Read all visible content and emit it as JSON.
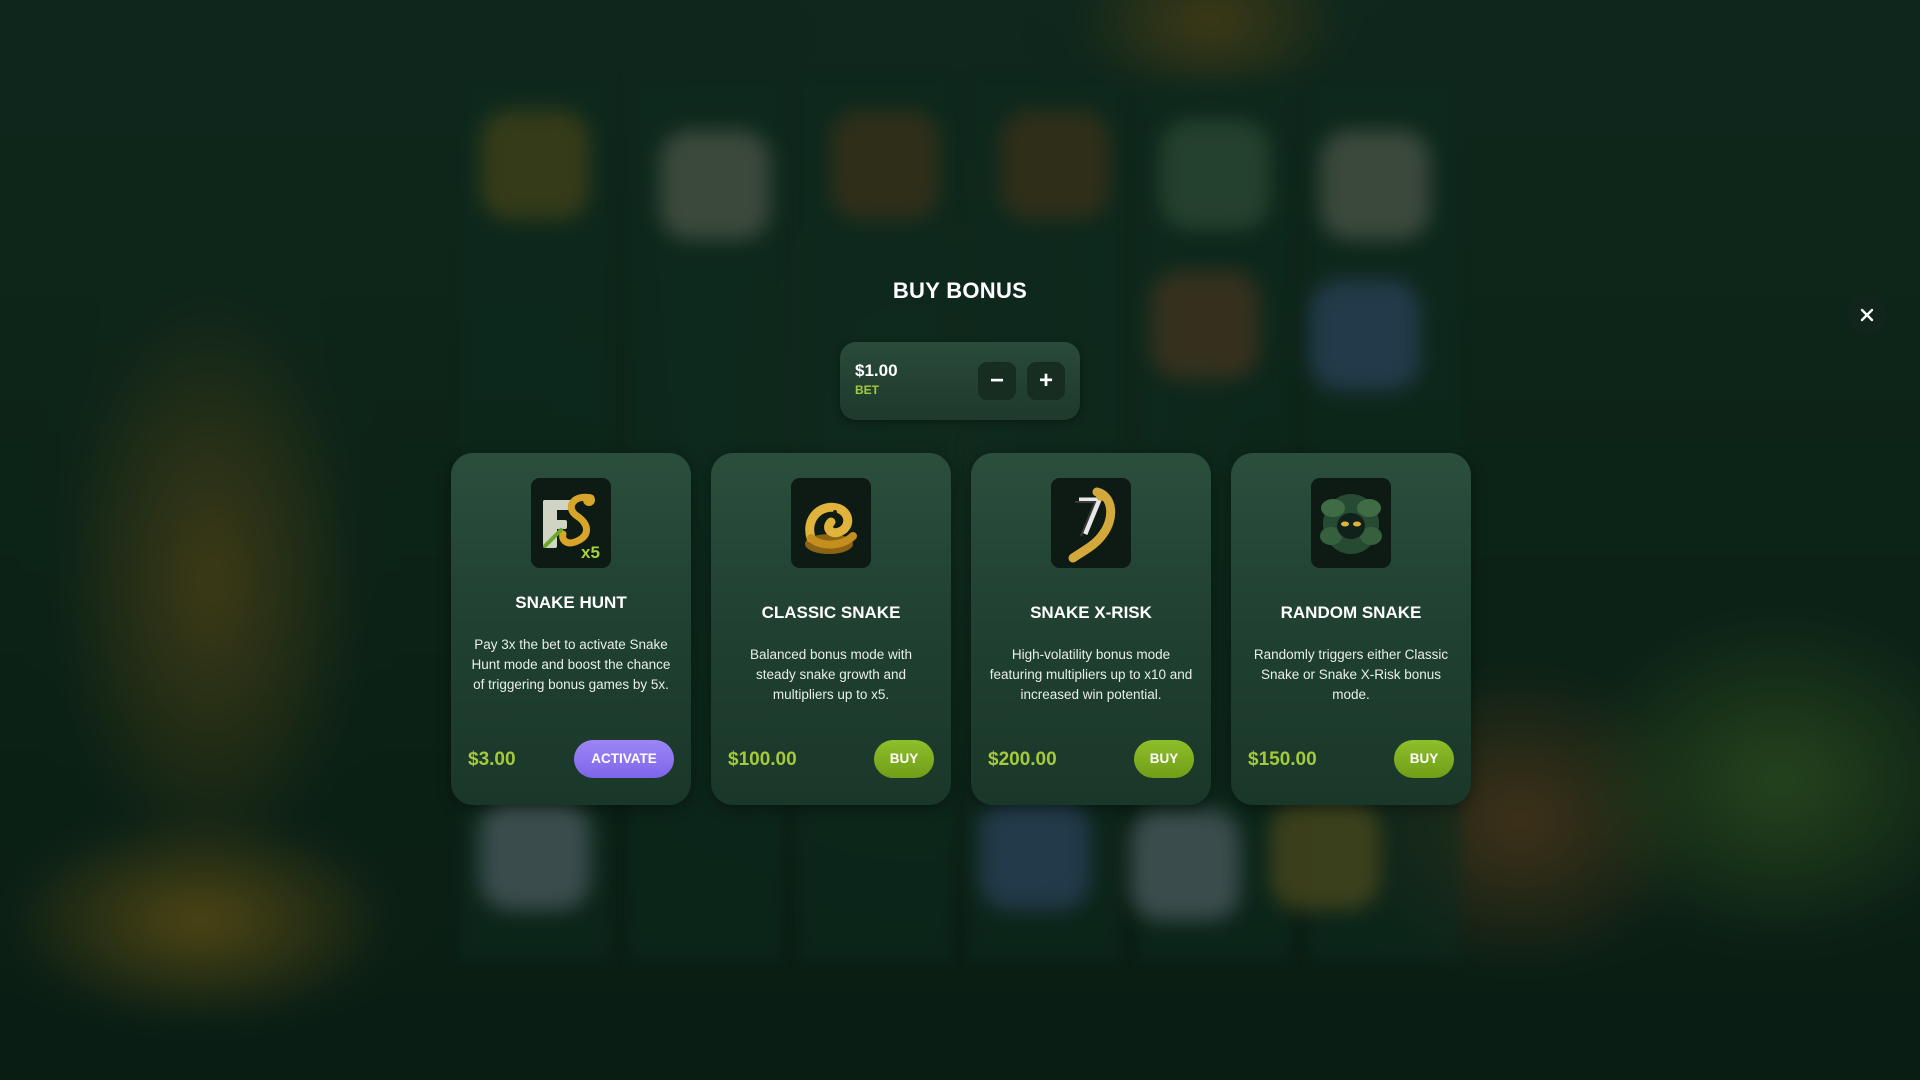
{
  "modal": {
    "title": "BUY BONUS",
    "close_icon": "close-icon"
  },
  "bet": {
    "value": "$1.00",
    "label": "BET",
    "minus_label": "−",
    "plus_label": "+"
  },
  "cards": [
    {
      "title": "SNAKE HUNT",
      "description": "Pay 3x the bet to activate Snake Hunt mode and boost the chance of triggering bonus games by 5x.",
      "price": "$3.00",
      "button_label": "ACTIVATE",
      "icon": "fs-snake-x5-icon",
      "icon_text": "x5"
    },
    {
      "title": "CLASSIC SNAKE",
      "description": "Balanced bonus mode with steady snake growth and multipliers up to x5.",
      "price": "$100.00",
      "button_label": "BUY",
      "icon": "golden-snake-icon"
    },
    {
      "title": "SNAKE X-RISK",
      "description": "High-volatility bonus mode featuring multipliers up to x10 and increased win potential.",
      "price": "$200.00",
      "button_label": "BUY",
      "icon": "snake-x-risk-icon"
    },
    {
      "title": "RANDOM SNAKE",
      "description": "Randomly triggers either Classic Snake or Snake X-Risk bonus mode.",
      "price": "$150.00",
      "button_label": "BUY",
      "icon": "jungle-mask-icon"
    }
  ],
  "colors": {
    "accent_green": "#a4c93a",
    "buy_button": "#7fae1f",
    "activate_button": "#8c75f0",
    "card_bg": "#234535"
  }
}
